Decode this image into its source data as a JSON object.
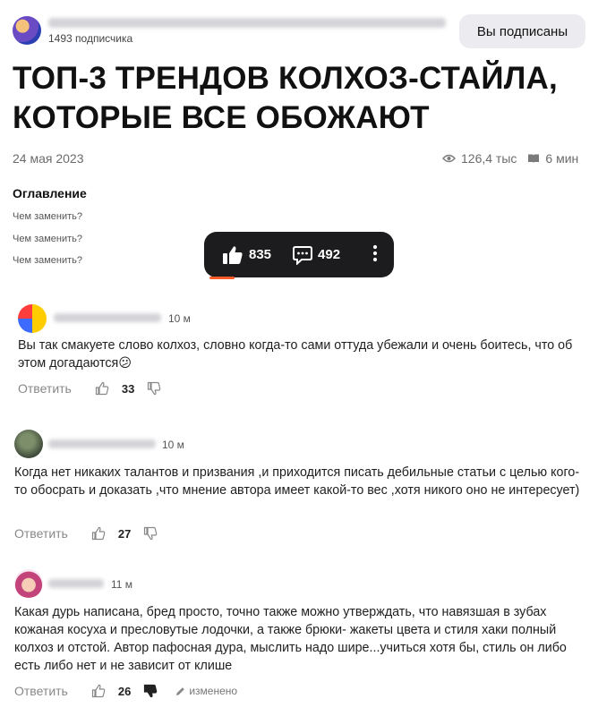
{
  "channel": {
    "name_blurred": "Вещи из мой профайла · Топ с профессиональной консультацией",
    "subscribers": "1493 подписчика",
    "subscribe_button": "Вы подписаны"
  },
  "article": {
    "title": "ТОП-3 ТРЕНДОВ КОЛХОЗ-СТАЙЛА, КОТОРЫЕ ВСЕ ОБОЖАЮТ",
    "date": "24 мая 2023",
    "views": "126,4 тыс",
    "read_time": "6 мин"
  },
  "toc": {
    "heading": "Оглавление",
    "items": [
      "Чем заменить?",
      "Чем заменить?",
      "Чем заменить?"
    ]
  },
  "action_bar": {
    "likes": "835",
    "comments": "492"
  },
  "comments": [
    {
      "author_blurred": "Чорная Пантера",
      "time": "10 м",
      "text": "Вы так смакуете слово колхоз, словно когда-то сами оттуда убежали и очень боитесь, что об этом догадаются😕",
      "reply_label": "Ответить",
      "likes": "33"
    },
    {
      "author_blurred": "Евгения Добрых",
      "time": "10 м",
      "text": "Когда нет никаких талантов и призвания ,и приходится писать дебильные статьи с целью кого-то обосрать и доказать ,что мнение автора имеет какой-то вес ,хотя никого оно не интересует)",
      "reply_label": "Ответить",
      "likes": "27"
    },
    {
      "author_blurred": "Маша",
      "time": "11 м",
      "text": "Какая дурь написана, бред просто, точно также можно утверждать, что навязшая в зубах кожаная косуха и пресловутые лодочки, а также брюки- жакеты цвета и стиля хаки полный колхоз и отстой. Автор пафосная дура, мыслить надо шире...учиться хотя бы, стиль он либо есть либо нет и не зависит от клише",
      "reply_label": "Ответить",
      "likes": "26",
      "edited_label": "изменено"
    }
  ],
  "colors": {
    "accent": "#ff5b29",
    "bar_bg": "#1c1c1e",
    "button_bg": "#ececf0"
  }
}
